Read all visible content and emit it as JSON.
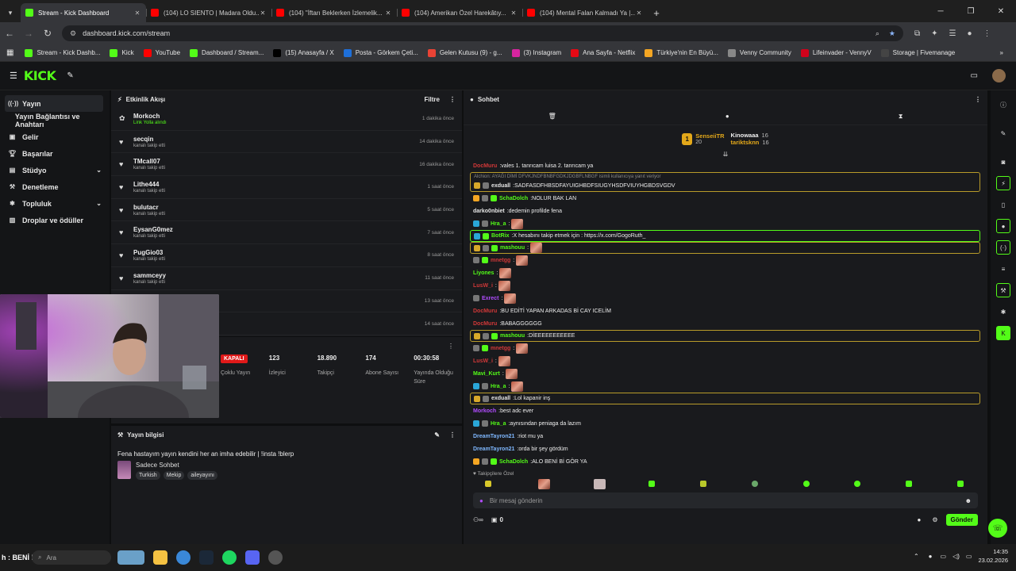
{
  "browser": {
    "tabs": [
      {
        "title": "Stream - Kick Dashboard",
        "color": "#53fc18",
        "active": true
      },
      {
        "title": "(104) LO SIENTO | Madara Oldu...",
        "color": "#ff0000"
      },
      {
        "title": "(104) \"İftarı Beklerken İzlemelik...",
        "color": "#ff0000"
      },
      {
        "title": "(104) Amerikan Özel Harekâtıy...",
        "color": "#ff0000"
      },
      {
        "title": "(104) Mental Falan Kalmadı Ya |...",
        "color": "#ff0000"
      }
    ],
    "url": "dashboard.kick.com/stream",
    "bookmarks": [
      {
        "label": "Stream - Kick Dashb...",
        "color": "#53fc18"
      },
      {
        "label": "Kick",
        "color": "#53fc18"
      },
      {
        "label": "YouTube",
        "color": "#ff0000"
      },
      {
        "label": "Dashboard / Stream...",
        "color": "#53fc18"
      },
      {
        "label": "(15) Anasayfa / X",
        "color": "#000000"
      },
      {
        "label": "Posta - Görkem Çeti...",
        "color": "#1e6fd9"
      },
      {
        "label": "Gelen Kutusu (9) - g...",
        "color": "#ea4335"
      },
      {
        "label": "(3) Instagram",
        "color": "#d6249f"
      },
      {
        "label": "Ana Sayfa - Netflix",
        "color": "#e50914"
      },
      {
        "label": "Türkiye'nin En Büyü...",
        "color": "#f5a623"
      },
      {
        "label": "Venny Community",
        "color": "#888888"
      },
      {
        "label": "Lifeinvader - VennyV",
        "color": "#d0021b"
      },
      {
        "label": "Storage | Fivemanage",
        "color": "#444444"
      }
    ]
  },
  "sidebar": {
    "items": [
      {
        "label": "Yayın",
        "icon": "broadcast-icon"
      },
      {
        "label": "Yayın Bağlantısı ve Anahtarı",
        "icon": ""
      },
      {
        "label": "Gelir",
        "icon": "money-icon"
      },
      {
        "label": "Başarılar",
        "icon": "trophy-icon"
      },
      {
        "label": "Stüdyo",
        "icon": "studio-icon"
      },
      {
        "label": "Denetleme",
        "icon": "hammer-icon"
      },
      {
        "label": "Topluluk",
        "icon": "community-icon"
      },
      {
        "label": "Droplar ve ödüller",
        "icon": "gift-icon"
      }
    ]
  },
  "activity": {
    "title": "Etkinlik Akışı",
    "filter": "Filtre",
    "items": [
      {
        "name": "Morkoch",
        "sub": "Link Yolla alındı",
        "time": "1 dakika önce",
        "highlight": true
      },
      {
        "name": "secqin",
        "sub": "kanalı takip etti",
        "time": "14 dakika önce"
      },
      {
        "name": "TMcall07",
        "sub": "kanalı takip etti",
        "time": "16 dakika önce"
      },
      {
        "name": "Lithe444",
        "sub": "kanalı takip etti",
        "time": "1 saat önce"
      },
      {
        "name": "bulutacr",
        "sub": "kanalı takip etti",
        "time": "5 saat önce"
      },
      {
        "name": "EysanG0mez",
        "sub": "kanalı takip etti",
        "time": "7 saat önce"
      },
      {
        "name": "PugGio03",
        "sub": "kanalı takip etti",
        "time": "8 saat önce"
      },
      {
        "name": "sammceyy",
        "sub": "kanalı takip etti",
        "time": "11 saat önce"
      },
      {
        "name": "",
        "sub": "",
        "time": "13 saat önce"
      },
      {
        "name": "",
        "sub": "",
        "time": "14 saat önce"
      }
    ]
  },
  "stats": {
    "status": "KAPALI",
    "items": [
      {
        "value": "",
        "label": "Çoklu Yayın"
      },
      {
        "value": "123",
        "label": "İzleyici"
      },
      {
        "value": "18.890",
        "label": "Takipçi"
      },
      {
        "value": "174",
        "label": "Abone Sayısı"
      },
      {
        "value": "00:30:58",
        "label": "Yayında Olduğu Süre"
      }
    ]
  },
  "info": {
    "title": "Yayın bilgisi",
    "stream_title": "Fena hastayım yayın kendini her an imha edebilir | !insta !blerp",
    "category": "Sadece Sohbet",
    "tags": [
      "Turkish",
      "Mekip",
      "aileyayını"
    ]
  },
  "chat": {
    "title": "Sohbet",
    "top": {
      "rank": "1",
      "gifter": "SenseiiTR",
      "gifter_count": "20",
      "u1": "Kinowaaa",
      "u1_count": "16",
      "u2": "tariktsknn",
      "u2_count": "16"
    },
    "reply_note": "Alchion: AYAĞI DİMİ DFVKJNDFBNBFGDKJDGBFLNBGF isimli kullanıcıya yanıt veriyor",
    "messages": [
      {
        "user": "DocMuru",
        "color": "#d13838",
        "text": "vales 1. tanrıcam luisa 2. tanrıcam ya"
      },
      {
        "user": "exduall",
        "color": "#e6e6e6",
        "text": "SADFASDFHBSDFAYUIGHBDFSIUGYHSDFVIUYHGBDSVGDV",
        "box": "gold",
        "badges": [
          "#d8a92a",
          "#777"
        ]
      },
      {
        "user": "SchaDolch",
        "color": "#53fc18",
        "text": "NOLUR BAK LAN",
        "badges": [
          "#f5a623",
          "#777",
          "#53fc18"
        ]
      },
      {
        "user": "darko0nbiet",
        "color": "#e6e6e6",
        "text": "dedemin profilde fena"
      },
      {
        "user": "Hra_a",
        "color": "#53fc18",
        "text": "",
        "emote": true,
        "badges": [
          "#2aa6d8",
          "#777"
        ]
      },
      {
        "user": "BotRix",
        "color": "#53fc18",
        "text": "X hesabını takip etmek için : https://x.com/GogoRuth_",
        "box": "green",
        "badges": [
          "#2aa6d8",
          "#53fc18"
        ]
      },
      {
        "user": "mashouu",
        "color": "#53fc18",
        "text": "",
        "emote": true,
        "box": "gold",
        "badges": [
          "#d8a92a",
          "#777",
          "#53fc18"
        ]
      },
      {
        "user": "mnetgg",
        "color": "#d13838",
        "text": "",
        "emote": true,
        "badges": [
          "#777",
          "#53fc18"
        ]
      },
      {
        "user": "Liyones",
        "color": "#53fc18",
        "text": "",
        "emote": true
      },
      {
        "user": "LusW_i",
        "color": "#d13838",
        "text": "",
        "emote": true
      },
      {
        "user": "Exrect",
        "color": "#b14cff",
        "text": "",
        "emote": true,
        "badges": [
          "#777"
        ]
      },
      {
        "user": "DocMuru",
        "color": "#d13838",
        "text": "BU EDİTİ YAPAN ARKADAS Bİ CAY ICELİM"
      },
      {
        "user": "DocMuru",
        "color": "#d13838",
        "text": "BABAGGGGGG"
      },
      {
        "user": "mashouu",
        "color": "#53fc18",
        "text": "DİEEEEEEEEEEE",
        "box": "gold",
        "badges": [
          "#d8a92a",
          "#777",
          "#53fc18"
        ]
      },
      {
        "user": "mnetgg",
        "color": "#d13838",
        "text": "",
        "emote": true,
        "badges": [
          "#777",
          "#53fc18"
        ]
      },
      {
        "user": "LusW_i",
        "color": "#d13838",
        "text": "",
        "emote": true
      },
      {
        "user": "Mavi_Kurt",
        "color": "#53fc18",
        "text": "",
        "emote": true
      },
      {
        "user": "Hra_a",
        "color": "#53fc18",
        "text": "",
        "emote": true,
        "badges": [
          "#2aa6d8",
          "#777"
        ]
      },
      {
        "user": "exduall",
        "color": "#e6e6e6",
        "text": "Lol kapanir inş",
        "box": "gold",
        "badges": [
          "#d8a92a",
          "#777"
        ]
      },
      {
        "user": "Morkoch",
        "color": "#b14cff",
        "text": "best adc ever"
      },
      {
        "user": "Hra_a",
        "color": "#53fc18",
        "text": "aynısından peniaga da lazım",
        "badges": [
          "#2aa6d8",
          "#777"
        ]
      },
      {
        "user": "DreamTayron21",
        "color": "#7fb8ff",
        "text": "riot mu ya"
      },
      {
        "user": "DreamTayron21",
        "color": "#7fb8ff",
        "text": "orda bir şey gördüm"
      },
      {
        "user": "SchaDolch",
        "color": "#53fc18",
        "text": "ALO BENİ Bİ GÖR YA",
        "badges": [
          "#f5a623",
          "#777",
          "#53fc18"
        ]
      }
    ],
    "followers_only": "Takipçilere Özel",
    "input_placeholder": "Bir mesaj gönderin",
    "send": "Gönder",
    "points": "0"
  },
  "taskbar": {
    "subtitle": "h : BENİ Bİ GÖR YA",
    "search": "Ara",
    "time": "14:35",
    "date": "23.02.2026"
  }
}
